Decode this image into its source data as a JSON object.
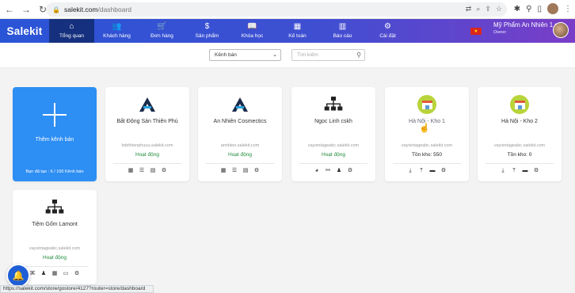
{
  "browser": {
    "url_host": "salekit.com",
    "url_path": "/dashboard",
    "status_url": "https://salekit.com/store/gostore/4127?router=store/dashboard"
  },
  "header": {
    "logo": "Salekit",
    "menu": [
      {
        "label": "Tổng quan",
        "icon": "home-icon",
        "glyph": "⌂"
      },
      {
        "label": "Khách hàng",
        "icon": "users-icon",
        "glyph": "👥"
      },
      {
        "label": "Đơn hàng",
        "icon": "cart-icon",
        "glyph": "🛒"
      },
      {
        "label": "Sản phẩm",
        "icon": "dollar-icon",
        "glyph": "$"
      },
      {
        "label": "Khóa học",
        "icon": "book-icon",
        "glyph": "📖"
      },
      {
        "label": "Kế toán",
        "icon": "calculator-icon",
        "glyph": "▦"
      },
      {
        "label": "Báo cáo",
        "icon": "chart-icon",
        "glyph": "▥"
      },
      {
        "label": "Cài đặt",
        "icon": "gear-icon",
        "glyph": "⚙"
      }
    ],
    "user_name": "Mỹ Phẩm An Nhiên 1",
    "user_role": "Owner",
    "flag_glyph": "★"
  },
  "filters": {
    "channel_select": "Kênh bán",
    "search_placeholder": "Tìm kiếm"
  },
  "add_card": {
    "label": "Thêm kênh bán",
    "count": "Bạn đã tạo : 6 / 100 Kênh bán"
  },
  "channels": [
    {
      "name": "Bất Động Sản Thiên Phú",
      "domain": "bdsthienphuuu.salekit.com",
      "line": "Hoạt động",
      "line_type": "status",
      "icon": "a-logo",
      "actions": [
        "▦",
        "☰",
        "▤",
        "⚙"
      ]
    },
    {
      "name": "An Nhiên Cosmectics",
      "domain": "annhien.salekit.com",
      "line": "Hoạt động",
      "line_type": "status",
      "icon": "a-logo",
      "actions": [
        "▦",
        "☰",
        "▤",
        "⚙"
      ]
    },
    {
      "name": "Ngọc Linh cskh",
      "domain": "vayvintageabc.salekit.com",
      "line": "Hoạt động",
      "line_type": "status",
      "icon": "sitemap",
      "actions": [
        "◕",
        "⚯",
        "♟",
        "⚙"
      ]
    },
    {
      "name": "Hà Nội - Kho 1",
      "domain": "vayvintageabc.salekit.com",
      "line": "Tồn kho: 550",
      "line_type": "stock",
      "icon": "shop",
      "actions": [
        "⤓",
        "⤒",
        "▬",
        "⚙"
      ]
    },
    {
      "name": "Hà Nội - Kho 2",
      "domain": "vayvintageabc.salekit.com",
      "line": "Tồn kho: 0",
      "line_type": "stock",
      "icon": "shop",
      "actions": [
        "⤓",
        "⤒",
        "▬",
        "⚙"
      ]
    },
    {
      "name": "Tiệm Gốm Lamont",
      "domain": "vayvintageabc.salekit.com",
      "line": "Hoạt động",
      "line_type": "status",
      "icon": "sitemap",
      "actions": [
        "⌘",
        "♟",
        "▦",
        "▭",
        "⚙"
      ]
    }
  ]
}
